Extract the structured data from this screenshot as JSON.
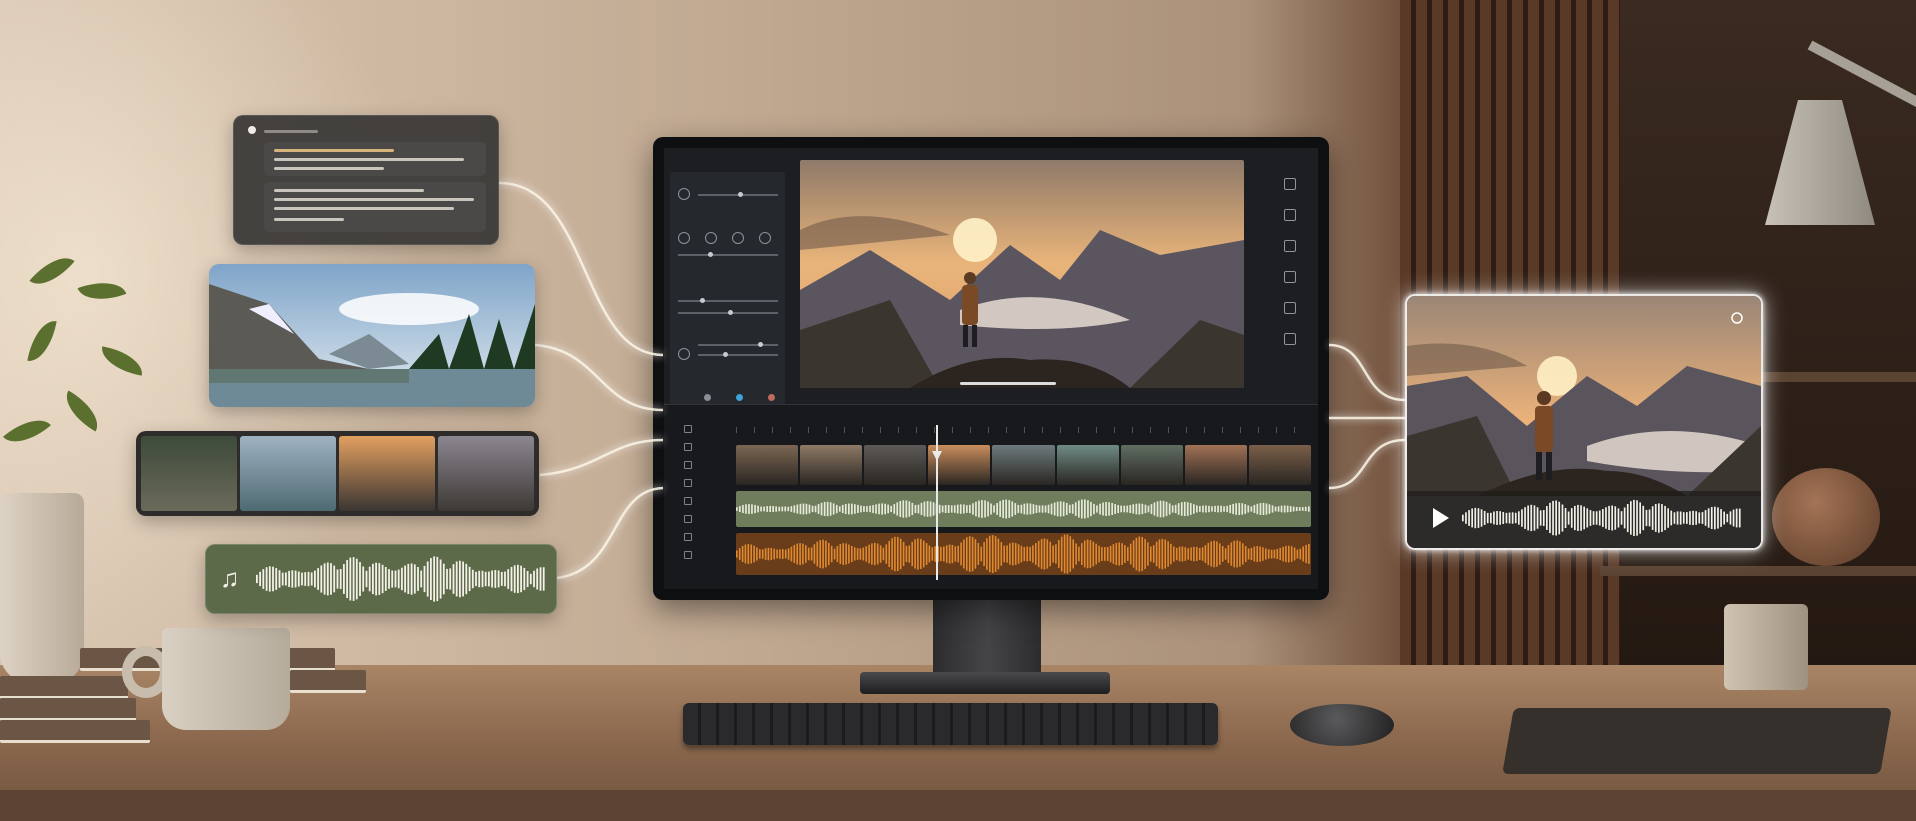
{
  "scene": {
    "description_free": true
  },
  "editor": {
    "project_title": "",
    "preview_caption": ""
  },
  "colors": {
    "accent_orange": "#e0892e",
    "audio_green": "#6f7d5c",
    "audio_card_green": "#5d6a4a",
    "connector_glow": "#f7efe0",
    "accent_blue": "#3ea3d8"
  },
  "icons": {
    "music_note": "music-note-icon",
    "play": "play-icon",
    "output_settings": "settings-icon"
  }
}
